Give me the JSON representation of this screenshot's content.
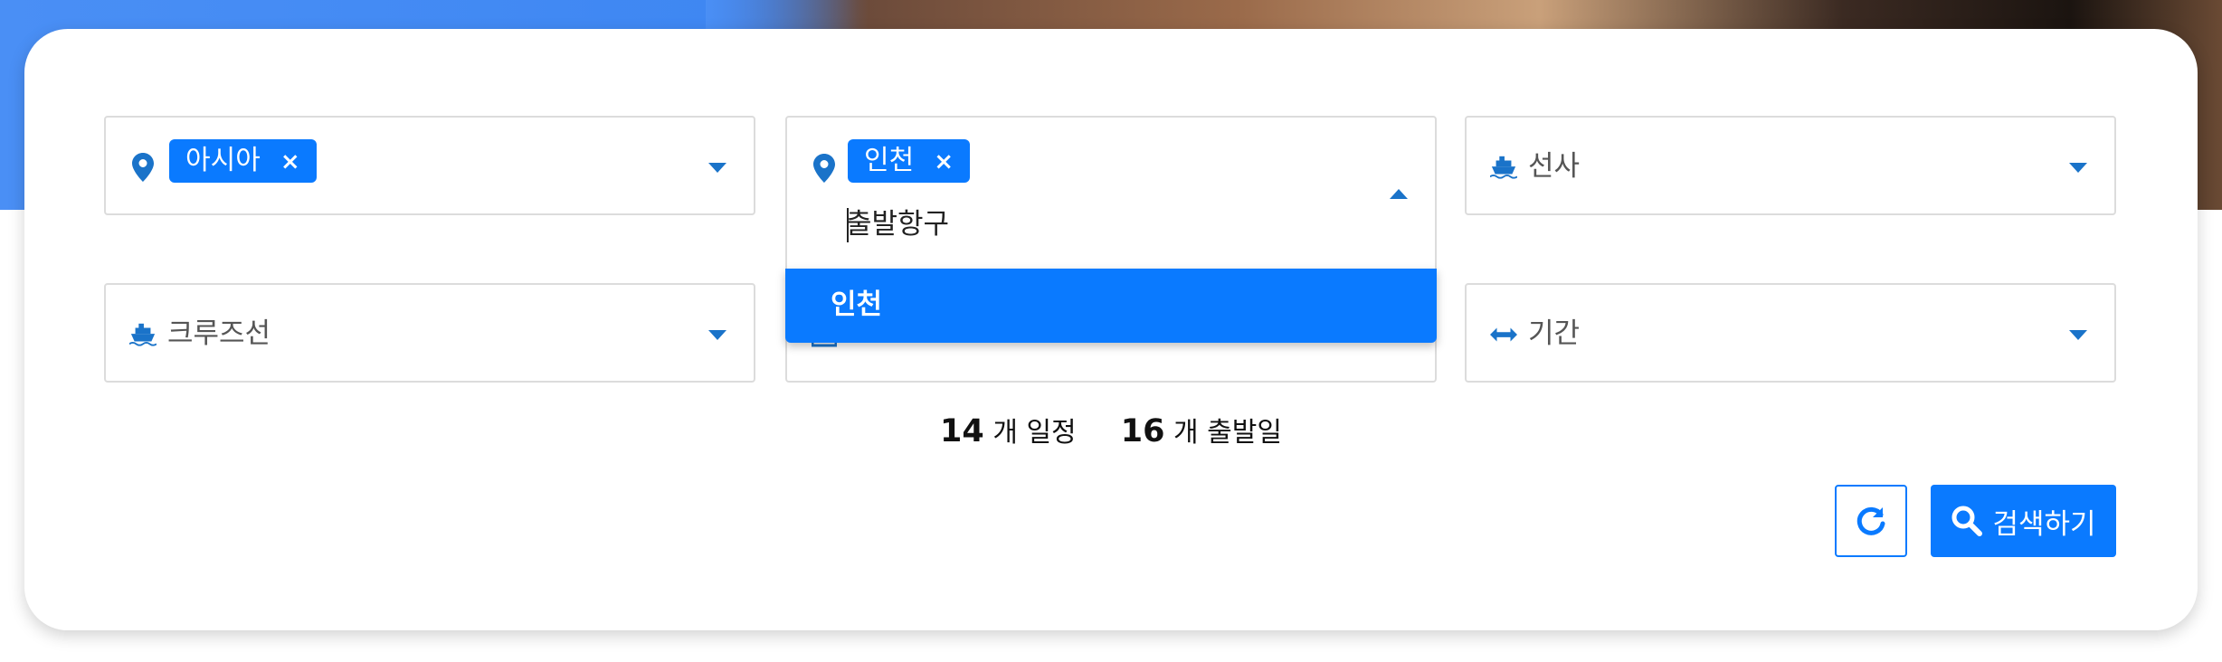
{
  "filters": {
    "region": {
      "tag": "아시아",
      "remove": "×"
    },
    "port": {
      "tag": "인천",
      "remove": "×",
      "input_value": "출발항구"
    },
    "cruise_line": {
      "label": "선사"
    },
    "ship": {
      "label": "크루즈선"
    },
    "duration": {
      "label": "기간"
    }
  },
  "dropdown": {
    "options": [
      "인천"
    ]
  },
  "summary": {
    "itineraries_count": "14",
    "itineraries_label": "개 일정",
    "departures_count": "16",
    "departures_label": "개 출발일"
  },
  "actions": {
    "search_label": "검색하기"
  },
  "colors": {
    "accent": "#0a7aff",
    "icon": "#1a73c9"
  },
  "icons": {
    "region": "map-pin-icon",
    "port": "map-pin-icon",
    "cruise_line": "ship-icon",
    "ship": "ship-icon",
    "duration": "horizontal-arrows-icon",
    "reset": "refresh-icon",
    "search": "search-icon"
  }
}
